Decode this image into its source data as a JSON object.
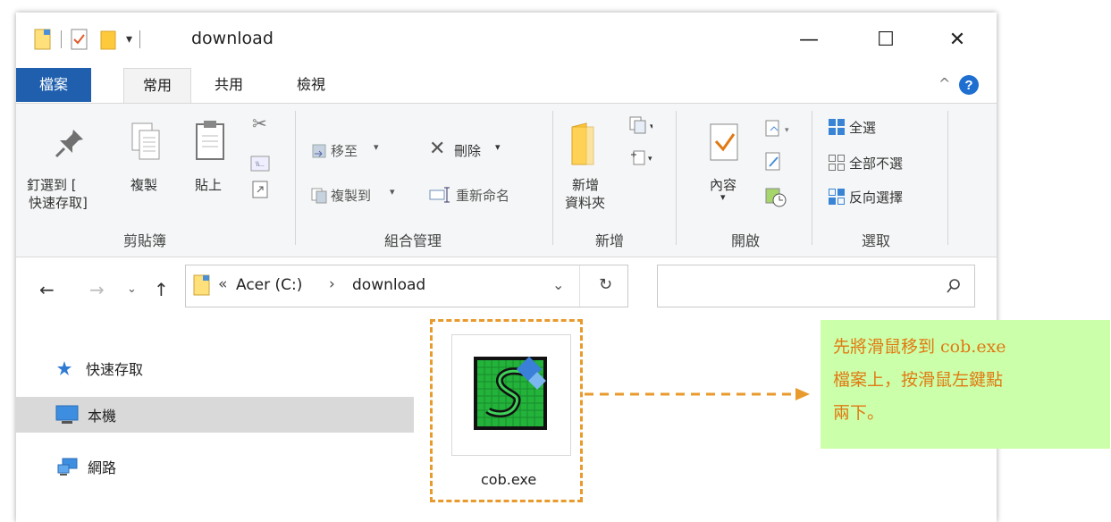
{
  "window": {
    "title": "download",
    "controls": {
      "minimize": "—",
      "maximize": "☐",
      "close": "✕"
    }
  },
  "ribbon_tabs": [
    "檔案",
    "常用",
    "共用",
    "檢視"
  ],
  "ribbon": {
    "clipboard": {
      "pin_label_1": "釘選到 [",
      "pin_label_2": "快速存取]",
      "copy": "複製",
      "paste": "貼上",
      "group_label": "剪貼簿"
    },
    "organize": {
      "move_to": "移至",
      "copy_to": "複製到",
      "delete": "刪除",
      "rename": "重新命名",
      "group_label": "組合管理"
    },
    "new": {
      "new_folder_1": "新增",
      "new_folder_2": "資料夾",
      "group_label": "新增"
    },
    "open": {
      "properties": "內容",
      "group_label": "開啟"
    },
    "select": {
      "select_all": "全選",
      "select_none": "全部不選",
      "invert": "反向選擇",
      "group_label": "選取"
    }
  },
  "address": {
    "prefix": "«",
    "segment1": "Acer (C:)",
    "separator": "›",
    "segment2": "download",
    "search_placeholder": ""
  },
  "nav_pane": [
    {
      "label": "快速存取",
      "icon": "star-pin-icon"
    },
    {
      "label": "本機",
      "icon": "computer-icon",
      "selected": true
    },
    {
      "label": "網路",
      "icon": "network-icon"
    }
  ],
  "files": [
    {
      "name": "cob.exe",
      "icon": "executable-icon"
    }
  ],
  "callout": {
    "line1": "先將滑鼠移到 cob.exe",
    "line2": "檔案上，按滑鼠左鍵點",
    "line3": "兩下。"
  },
  "colors": {
    "annotation_orange": "#e89a2c",
    "callout_bg": "#ccffaa",
    "file_tab": "#1f5fae"
  }
}
